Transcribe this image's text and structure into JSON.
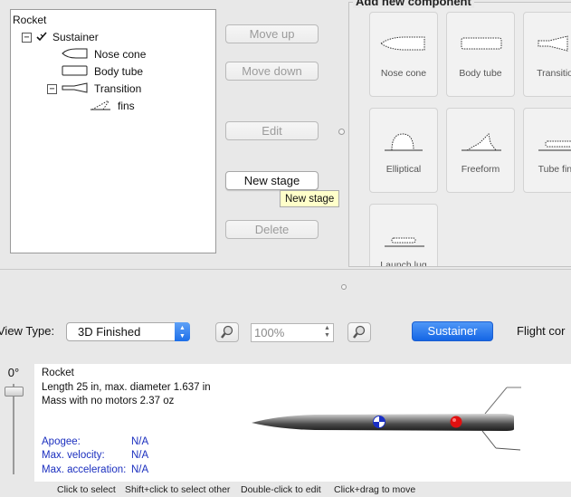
{
  "tree": {
    "root": "Rocket",
    "sustainer": "Sustainer",
    "nose_cone": "Nose cone",
    "body_tube": "Body tube",
    "transition": "Transition",
    "fins": "fins"
  },
  "actions": {
    "move_up": "Move up",
    "move_down": "Move down",
    "edit": "Edit",
    "new_stage": "New stage",
    "delete": "Delete",
    "tooltip": "New stage"
  },
  "palette": {
    "title": "Add new component",
    "items": [
      "Nose cone",
      "Body tube",
      "Transition",
      "Elliptical",
      "Freeform",
      "Tube fins",
      "Launch lug"
    ]
  },
  "toolbar": {
    "view_type_label": "View Type:",
    "view_type_value": "3D Finished",
    "zoom_value": "100%",
    "stage_button": "Sustainer",
    "flight_label": "Flight cor"
  },
  "figure": {
    "rotation": "0°",
    "name": "Rocket",
    "dimensions": "Length 25 in, max. diameter 1.637 in",
    "mass": "Mass with no motors 2.37 oz",
    "apogee_label": "Apogee:",
    "apogee_value": "N/A",
    "velocity_label": "Max. velocity:",
    "velocity_value": "N/A",
    "accel_label": "Max. acceleration:",
    "accel_value": "N/A",
    "colors": {
      "cg": "#1a2fc4",
      "cp": "#e01010"
    }
  },
  "status": {
    "click": "Click to select",
    "shift": "Shift+click to select other",
    "dbl": "Double-click to edit",
    "drag": "Click+drag to move"
  }
}
